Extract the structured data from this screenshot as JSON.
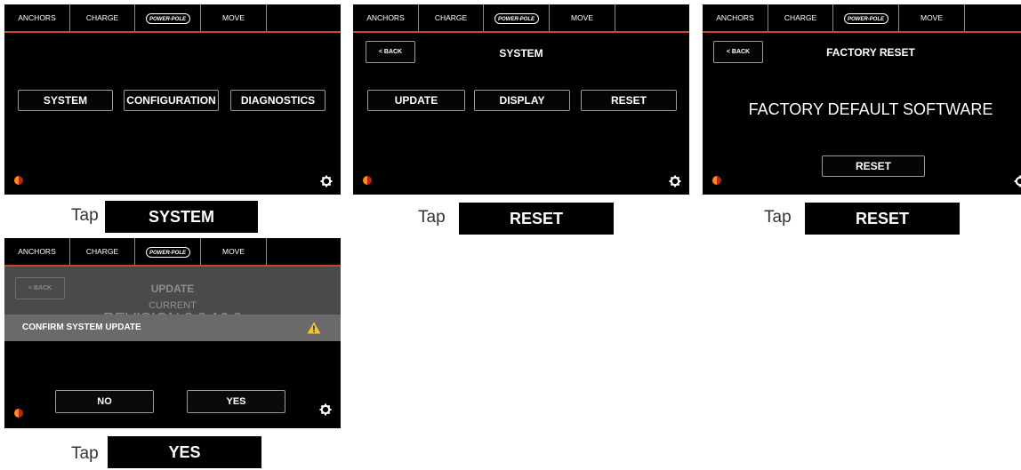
{
  "tabs": [
    "ANCHORS",
    "CHARGE",
    "POWER-POLE",
    "MOVE",
    ""
  ],
  "screen1": {
    "buttons": [
      "SYSTEM",
      "CONFIGURATION",
      "DIAGNOSTICS"
    ]
  },
  "screen2": {
    "back": "< BACK",
    "title": "SYSTEM",
    "buttons": [
      "UPDATE",
      "DISPLAY",
      "RESET"
    ]
  },
  "screen3": {
    "back": "< BACK",
    "title": "FACTORY RESET",
    "message": "FACTORY DEFAULT SOFTWARE",
    "button": "RESET"
  },
  "screen4": {
    "back": "< BACK",
    "title": "UPDATE",
    "current": "CURRENT",
    "revision": "REVISION 2.3.16.3",
    "confirm": "CONFIRM SYSTEM UPDATE",
    "no": "NO",
    "yes": "YES"
  },
  "steps": [
    {
      "word": "Tap",
      "button": "SYSTEM"
    },
    {
      "word": "Tap",
      "button": "RESET"
    },
    {
      "word": "Tap",
      "button": "RESET"
    },
    {
      "word": "Tap",
      "button": "YES"
    }
  ],
  "colors": {
    "accent": "#c8472f",
    "warning": "#f3c33a",
    "contrast_left": "#ff8a1e",
    "contrast_right": "#c91f12"
  }
}
